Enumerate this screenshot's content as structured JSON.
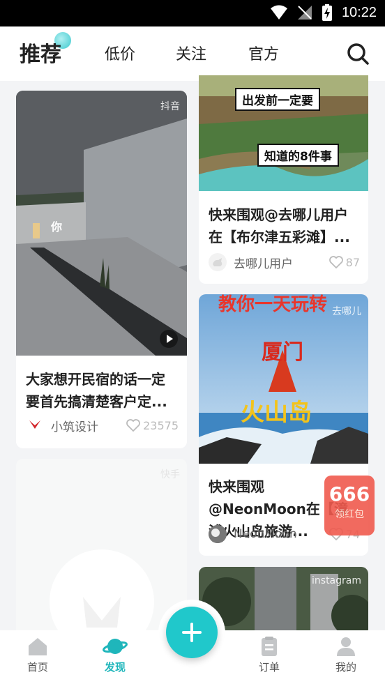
{
  "status_bar": {
    "time": "10:22"
  },
  "top_nav": {
    "tabs": [
      {
        "label": "推荐"
      },
      {
        "label": "低价"
      },
      {
        "label": "关注"
      },
      {
        "label": "官方"
      }
    ]
  },
  "feed": {
    "cards": [
      {
        "source": "抖音",
        "image_text": "你",
        "title": "大家想开民宿的话一定要首先搞清楚客户定...",
        "author": "小筑设计",
        "likes": "23575"
      },
      {
        "source": "快手"
      },
      {
        "image_banner_top": "出发前一定要",
        "image_banner_bottom": "知道的8件事",
        "title": "快来围观@去哪儿用户在【布尔津五彩滩】...",
        "author": "去哪儿用户",
        "likes": "87"
      },
      {
        "source": "去哪儿",
        "image_text_top": "教你一天玩转",
        "image_text_mid": "厦门",
        "image_text_bottom": "火山岛",
        "title": "快来围观@NeonMoon在【漳浦火山岛旅游...",
        "author": "NeonMoon",
        "likes": "74"
      },
      {
        "source": "instagram"
      }
    ]
  },
  "red_packet": {
    "amount": "666",
    "label": "领红包"
  },
  "bottom_nav": {
    "items": [
      {
        "label": "首页"
      },
      {
        "label": "发现"
      },
      {
        "label": "订单"
      },
      {
        "label": "我的"
      }
    ]
  },
  "colors": {
    "accent": "#1fb6bb",
    "fab": "#20c8cb",
    "red_packet": "#f05a4e"
  }
}
